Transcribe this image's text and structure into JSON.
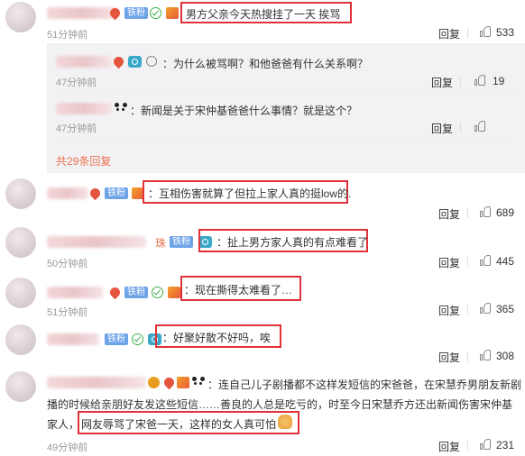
{
  "comments": [
    {
      "badge": "铁粉",
      "separator": "：",
      "text": "男方父亲今天热搜挂了一天 挨骂",
      "time": "51分钟前",
      "reply_label": "回复",
      "likes": "533",
      "replies": [
        {
          "text": "：为什么被骂啊？和他爸爸有什么关系啊？",
          "time": "47分钟前",
          "reply_label": "回复",
          "likes": "19"
        },
        {
          "text": "：新闻是关于宋仲基爸爸什么事情？就是这个？",
          "time": "47分钟前",
          "reply_label": "回复",
          "likes": ""
        }
      ],
      "more_replies": "共29条回复"
    },
    {
      "badge": "铁粉",
      "text": "：互相伤害就算了但拉上家人真的挺low的.",
      "time": "",
      "reply_label": "回复",
      "likes": "689"
    },
    {
      "badge": "铁粉",
      "name_fragment": "珠",
      "text": "：扯上男方家人真的有点难看了",
      "time": "50分钟前",
      "reply_label": "回复",
      "likes": "445"
    },
    {
      "badge": "铁粉",
      "text": "：现在撕得太难看了…",
      "time": "51分钟前",
      "reply_label": "回复",
      "likes": "365"
    },
    {
      "badge": "铁粉",
      "text": "：好聚好散不好吗，唉",
      "time": "51分钟前",
      "reply_label": "回复",
      "likes": "308"
    },
    {
      "text_line1": "：连自己儿子剧播都不这样发短信的宋爸爸，在宋慧乔男朋友新剧",
      "text_line2": "播的时候给亲朋好友发这些短信……善良的人总是吃亏的，时至今日宋慧乔方还出新闻伤害宋仲基",
      "text_line3a": "家人，",
      "text_line3b": "网友辱骂了宋爸一天，这样的女人真可怕",
      "time": "49分钟前",
      "reply_label": "回复",
      "likes": "231"
    }
  ],
  "colors": {
    "highlight_box": "#e1313a",
    "more_link": "#eb7350",
    "badge_bg": "#6fa3e8"
  }
}
